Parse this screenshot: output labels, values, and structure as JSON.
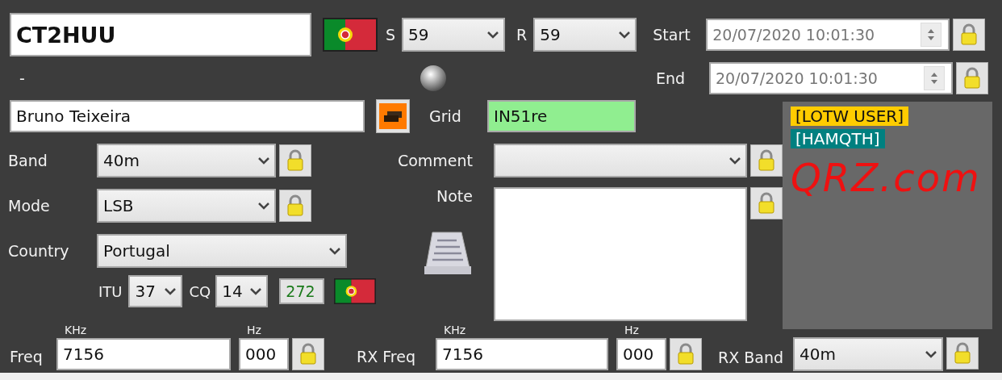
{
  "callsign": {
    "value": "CT2HUU"
  },
  "reports": [
    {
      "label": "S",
      "value": "59"
    },
    {
      "label": "R",
      "value": "59"
    }
  ],
  "times": [
    {
      "label": "Start",
      "value": "20/07/2020 10:01:30"
    },
    {
      "label": "End",
      "value": "20/07/2020 10:01:30"
    }
  ],
  "status_text": "-",
  "name": {
    "value": "Bruno Teixeira"
  },
  "grid": {
    "label": "Grid",
    "value": "IN51re"
  },
  "band": {
    "label": "Band",
    "value": "40m"
  },
  "mode": {
    "label": "Mode",
    "value": "LSB"
  },
  "comment": {
    "label": "Comment"
  },
  "note": {
    "label": "Note"
  },
  "country": {
    "label": "Country",
    "value": "Portugal",
    "itu_label": "ITU",
    "itu": "37",
    "cq_label": "CQ",
    "cq": "14",
    "dxcc": "272"
  },
  "info_tags": [
    {
      "text": "[LOTW USER]",
      "color": "#ffcc00"
    },
    {
      "text": "[HAMQTH]",
      "color": "#008080"
    }
  ],
  "scribble": "QRZ.com",
  "freq": {
    "label": "Freq",
    "khz_label": "KHz",
    "khz": "7156",
    "hz_label": "Hz",
    "hz": "000"
  },
  "rx_freq": {
    "label": "RX Freq",
    "khz_label": "KHz",
    "khz": "7156",
    "hz_label": "Hz",
    "hz": "000"
  },
  "rx_band": {
    "label": "RX Band",
    "value": "40m"
  }
}
